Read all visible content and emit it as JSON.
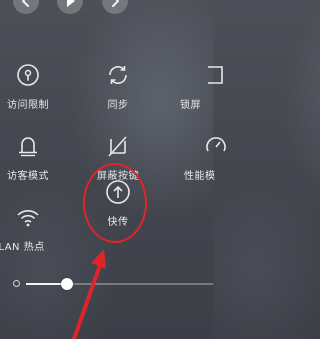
{
  "media": {
    "controls": [
      "previous-icon",
      "play-icon",
      "next-icon"
    ]
  },
  "tiles": [
    {
      "name": "access-limit",
      "label": "访问限制",
      "icon": "lock-clock-icon"
    },
    {
      "name": "sync",
      "label": "同步",
      "icon": "sync-icon"
    },
    {
      "name": "lock-screen",
      "label": "锁屏",
      "icon": "lock-screen-icon"
    },
    {
      "name": "guest-mode",
      "label": "访客模式",
      "icon": "bell-icon"
    },
    {
      "name": "block-keys",
      "label": "屏蔽按键",
      "icon": "block-keys-icon"
    },
    {
      "name": "performance",
      "label": "性能模",
      "icon": "gauge-icon"
    },
    {
      "name": "wlan-hotspot",
      "label": "WLAN 热点",
      "icon": "wifi-hotspot-icon"
    },
    {
      "name": "quick-transfer",
      "label": "快传",
      "icon": "upload-icon"
    }
  ],
  "brightness": {
    "level": 0.22
  },
  "annotation": {
    "color": "#e0252a"
  }
}
